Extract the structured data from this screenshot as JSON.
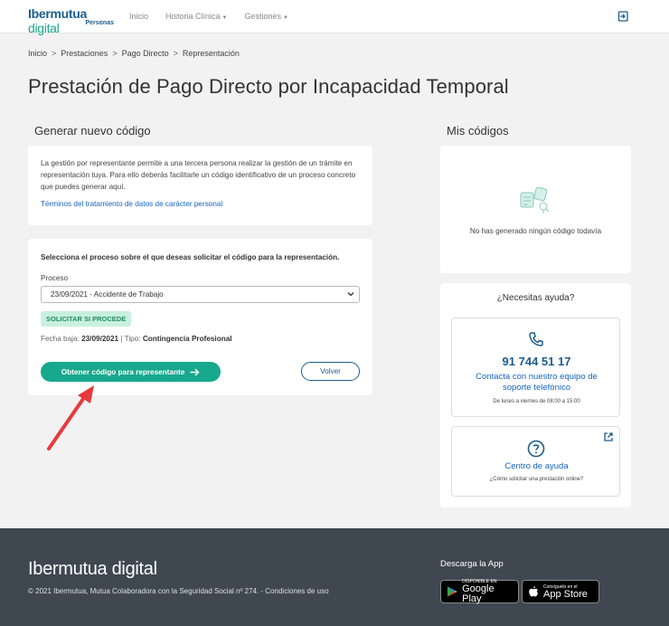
{
  "nav": {
    "logo_main": "Ibermutua",
    "logo_digital": "digital",
    "logo_sub": "Personas",
    "links": [
      "Inicio",
      "Historia Clínica",
      "Gestiones"
    ]
  },
  "breadcrumb": [
    "Inicio",
    "Prestaciones",
    "Pago Directo",
    "Representación"
  ],
  "breadcrumb_sep": ">",
  "page_title": "Prestación de Pago Directo por Incapacidad Temporal",
  "left": {
    "heading": "Generar nuevo código",
    "info_text": "La gestión por representante permite a una tercera persona realizar la gestión de un trámite en representación tuya. Para ello deberás facilitarle un código identificativo de un proceso concreto que puedes generar aquí.",
    "terms_link": "Términos del tratamiento de datos de carácter personal",
    "select_prompt": "Selecciona el proceso sobre el que deseas solicitar el código para la representación.",
    "proceso_label": "Proceso",
    "proceso_value": "23/09/2021 - Accidente de Trabajo",
    "badge": "SOLICITAR SI PROCEDE",
    "fecha_label": "Fecha baja:",
    "fecha_value": "23/09/2021",
    "tipo_sep": "|",
    "tipo_label": "Tipo:",
    "tipo_value": "Contingencia Profesional",
    "btn_generate": "Obtener código para representante",
    "btn_back": "Volver"
  },
  "right": {
    "heading": "Mis códigos",
    "empty_text": "No has generado ningún código todavía",
    "help_title": "¿Necesitas ayuda?",
    "phone": "91 744 51 17",
    "phone_desc": "Contacta con nuestro equipo de soporte telefónico",
    "phone_hours": "De lunes a viernes de 08:00 a 15:00",
    "help_center": "Centro de ayuda",
    "help_center_sub": "¿Cómo solicitar una prestación online?"
  },
  "footer": {
    "logo": "Ibermutua digital",
    "copyright": "© 2021 Ibermutua, Mutua Colaboradora con la Seguridad Social nº 274. - Condiciones de uso",
    "app_heading": "Descarga la App",
    "gp_small": "DISPONIBLE EN",
    "gp_big": "Google Play",
    "as_small": "Consíguelo en el",
    "as_big": "App Store"
  },
  "colors": {
    "accent": "#17a88d",
    "brand": "#1b5d8f",
    "link": "#1565c0",
    "footer": "#3f4850",
    "annotation_arrow": "#e8393a"
  }
}
